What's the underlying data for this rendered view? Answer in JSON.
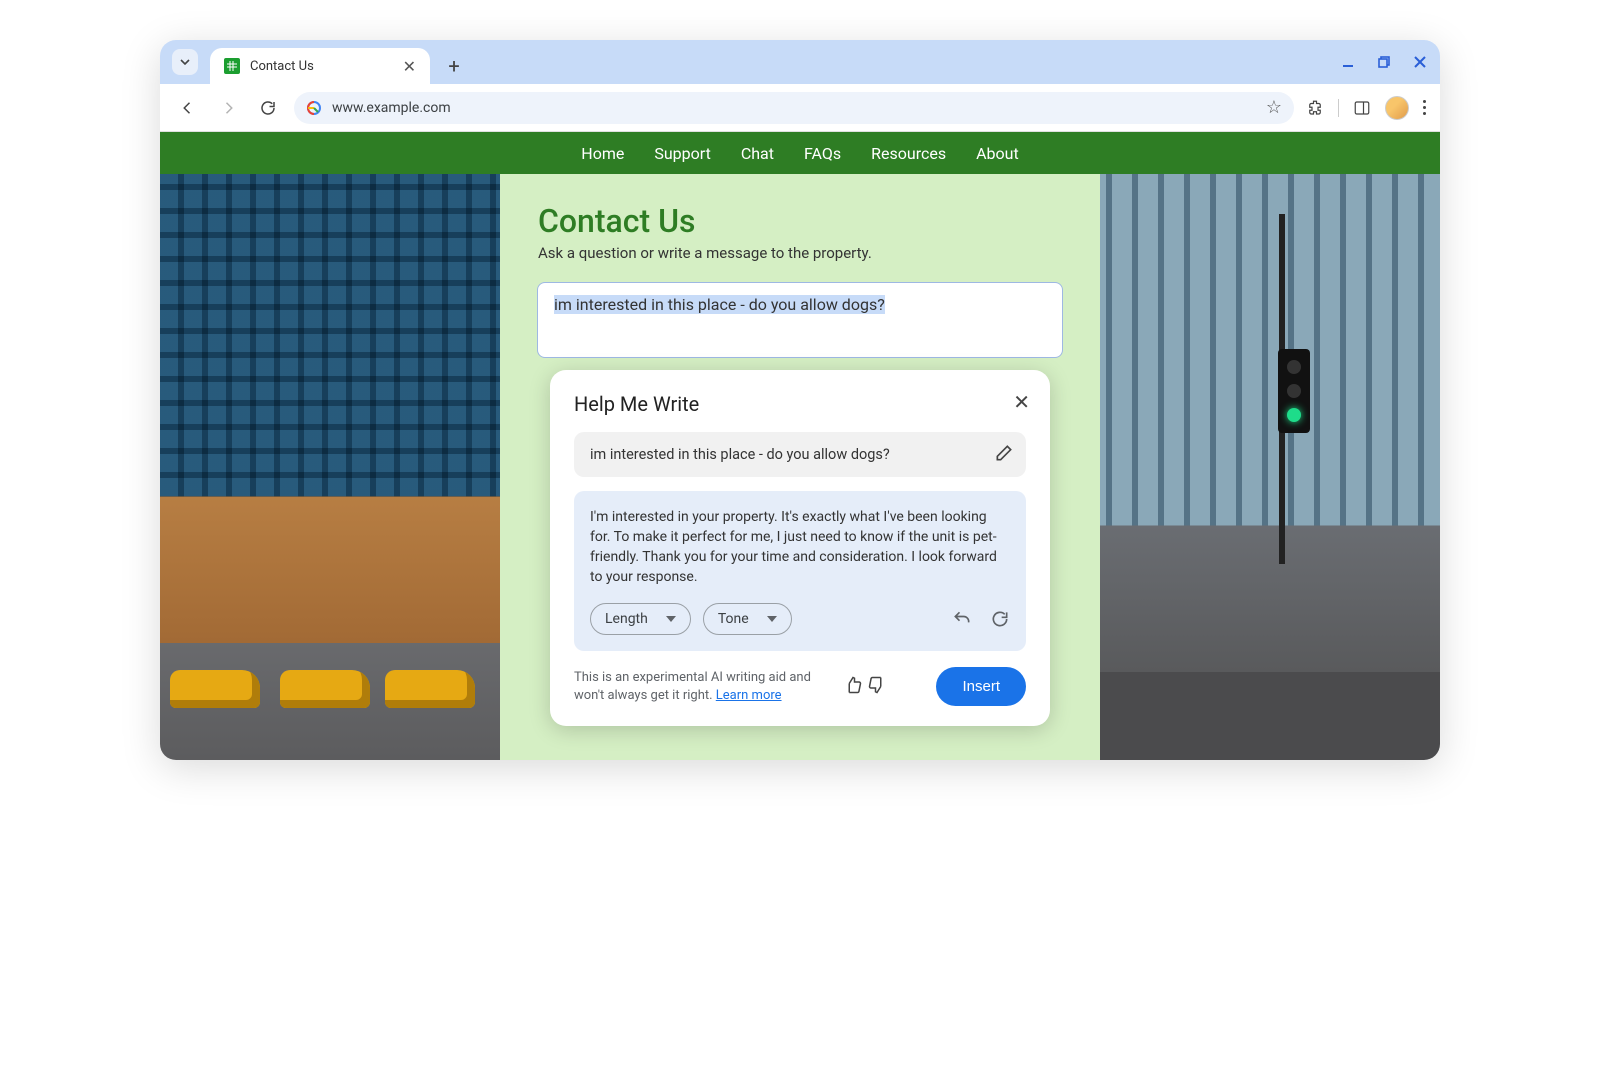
{
  "browser": {
    "tab_title": "Contact Us",
    "url": "www.example.com"
  },
  "site_nav": {
    "items": [
      "Home",
      "Support",
      "Chat",
      "FAQs",
      "Resources",
      "About"
    ]
  },
  "page": {
    "title": "Contact Us",
    "subtitle": "Ask a question or write a message to the property.",
    "message_value": "im interested in this place - do you allow dogs?"
  },
  "hmw": {
    "title": "Help Me Write",
    "prompt": "im interested in this place - do you allow dogs?",
    "suggestion": "I'm interested in your property. It's exactly what I've been looking for. To make it perfect for me, I just need to know if the unit is pet-friendly. Thank you for your time and consideration. I look forward to your response.",
    "length_label": "Length",
    "tone_label": "Tone",
    "disclaimer": "This is an experimental AI writing aid and won't always get it right. ",
    "learn_more": "Learn more",
    "insert_label": "Insert"
  }
}
